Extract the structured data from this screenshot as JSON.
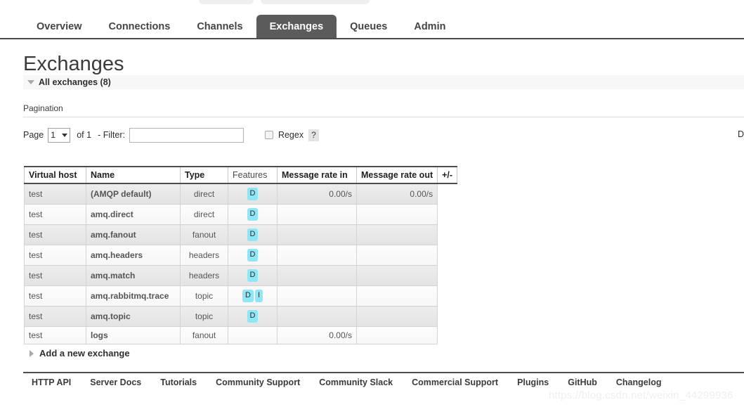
{
  "nav": {
    "tabs": [
      {
        "label": "Overview",
        "active": false
      },
      {
        "label": "Connections",
        "active": false
      },
      {
        "label": "Channels",
        "active": false
      },
      {
        "label": "Exchanges",
        "active": true
      },
      {
        "label": "Queues",
        "active": false
      },
      {
        "label": "Admin",
        "active": false
      }
    ]
  },
  "page": {
    "title": "Exchanges",
    "section_label": "All exchanges (8)"
  },
  "pagination": {
    "heading": "Pagination",
    "page_label": "Page",
    "page_value": "1",
    "of_text": "of 1",
    "filter_label": "- Filter:",
    "filter_value": "",
    "filter_placeholder": "",
    "regex_label": "Regex",
    "help_label": "?",
    "displaying_cutoff": "D"
  },
  "table": {
    "columns": [
      "Virtual host",
      "Name",
      "Type",
      "Features",
      "Message rate in",
      "Message rate out"
    ],
    "plusminus_label": "+/-",
    "rows": [
      {
        "vhost": "test",
        "name": "(AMQP default)",
        "type": "direct",
        "features": [
          "D"
        ],
        "rate_in": "0.00/s",
        "rate_out": "0.00/s"
      },
      {
        "vhost": "test",
        "name": "amq.direct",
        "type": "direct",
        "features": [
          "D"
        ],
        "rate_in": "",
        "rate_out": ""
      },
      {
        "vhost": "test",
        "name": "amq.fanout",
        "type": "fanout",
        "features": [
          "D"
        ],
        "rate_in": "",
        "rate_out": ""
      },
      {
        "vhost": "test",
        "name": "amq.headers",
        "type": "headers",
        "features": [
          "D"
        ],
        "rate_in": "",
        "rate_out": ""
      },
      {
        "vhost": "test",
        "name": "amq.match",
        "type": "headers",
        "features": [
          "D"
        ],
        "rate_in": "",
        "rate_out": ""
      },
      {
        "vhost": "test",
        "name": "amq.rabbitmq.trace",
        "type": "topic",
        "features": [
          "D",
          "I"
        ],
        "rate_in": "",
        "rate_out": ""
      },
      {
        "vhost": "test",
        "name": "amq.topic",
        "type": "topic",
        "features": [
          "D"
        ],
        "rate_in": "",
        "rate_out": ""
      },
      {
        "vhost": "test",
        "name": "logs",
        "type": "fanout",
        "features": [],
        "rate_in": "0.00/s",
        "rate_out": ""
      }
    ]
  },
  "add_exchange": {
    "label": "Add a new exchange"
  },
  "footer": {
    "links": [
      "HTTP API",
      "Server Docs",
      "Tutorials",
      "Community Support",
      "Community Slack",
      "Commercial Support",
      "Plugins",
      "GitHub",
      "Changelog"
    ]
  },
  "watermark": {
    "text": "https://blog.csdn.net/weixin_44299936"
  },
  "colors": {
    "active_tab_bg": "#5b5b5b",
    "badge_bg": "#8fe6f7",
    "row_odd_bg": "#e8e8e8",
    "row_even_bg": "#fafafa",
    "rule_dark": "#4d4d4d"
  }
}
